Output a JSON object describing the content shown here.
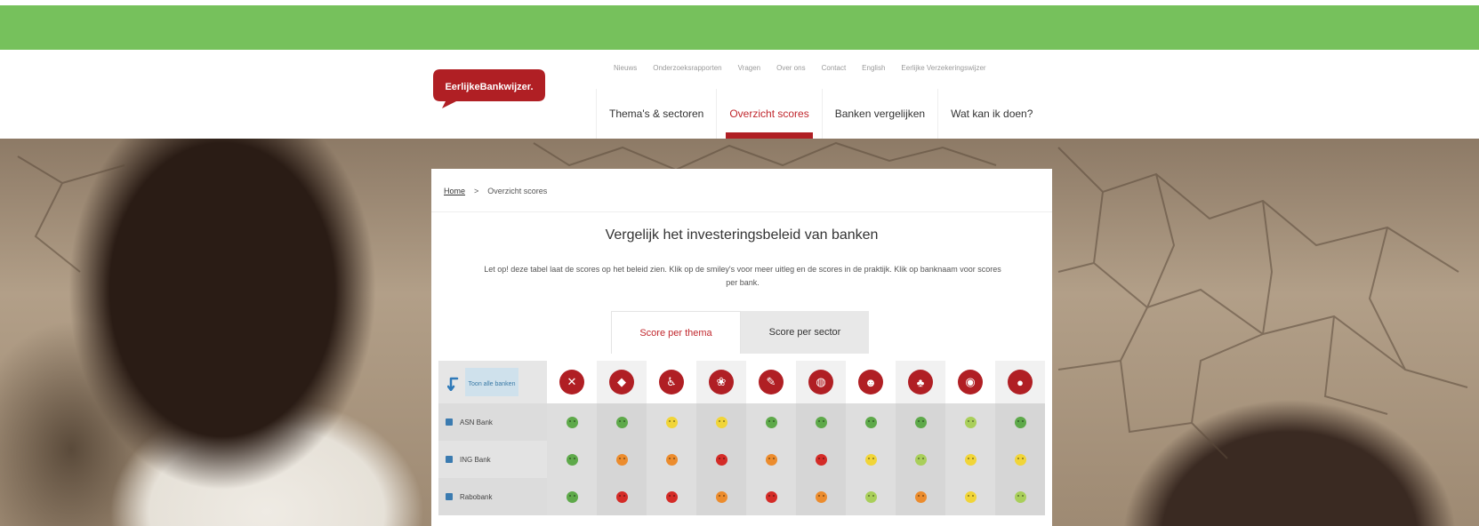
{
  "header": {
    "logo_text": "EerlijkeBankwijzer.",
    "util_nav": [
      "Nieuws",
      "Onderzoeksrapporten",
      "Vragen",
      "Over ons",
      "Contact",
      "English",
      "Eerlijke Verzekeringswijzer"
    ],
    "main_nav": [
      {
        "label": "Thema's & sectoren",
        "active": false
      },
      {
        "label": "Overzicht scores",
        "active": true
      },
      {
        "label": "Banken vergelijken",
        "active": false
      },
      {
        "label": "Wat kan ik doen?",
        "active": false
      }
    ]
  },
  "breadcrumb": {
    "home": "Home",
    "separator": ">",
    "current": "Overzicht scores"
  },
  "title": "Vergelijk het investeringsbeleid van banken",
  "intro": "Let op! deze tabel laat de scores op het beleid zien. Klik op de smiley's voor meer uitleg en de scores in de praktijk. Klik op banknaam voor scores per bank.",
  "tabs": [
    {
      "label": "Score per thema",
      "active": true
    },
    {
      "label": "Score per sector",
      "active": false
    }
  ],
  "table": {
    "show_all_label": "Toon alle banken",
    "themes": [
      {
        "icon": "tools-icon",
        "glyph": "✕"
      },
      {
        "icon": "tag-icon",
        "glyph": "◆"
      },
      {
        "icon": "person-chair-icon",
        "glyph": "♿"
      },
      {
        "icon": "paw-icon",
        "glyph": "❀"
      },
      {
        "icon": "pencil-icon",
        "glyph": "✎"
      },
      {
        "icon": "globe-icon",
        "glyph": "◍"
      },
      {
        "icon": "people-icon",
        "glyph": "☻"
      },
      {
        "icon": "tree-icon",
        "glyph": "♣"
      },
      {
        "icon": "eye-icon",
        "glyph": "◉"
      },
      {
        "icon": "drop-icon",
        "glyph": "●"
      }
    ],
    "rows": [
      {
        "bank": "ASN Bank",
        "scores": [
          "green",
          "green",
          "yellow",
          "yellow",
          "green",
          "green",
          "green",
          "green",
          "lime",
          "green"
        ]
      },
      {
        "bank": "ING Bank",
        "scores": [
          "green",
          "orange",
          "orange",
          "red",
          "orange",
          "red",
          "yellow",
          "lime",
          "yellow",
          "yellow"
        ]
      },
      {
        "bank": "Rabobank",
        "scores": [
          "green",
          "red",
          "red",
          "orange",
          "red",
          "orange",
          "lime",
          "orange",
          "yellow",
          "lime"
        ]
      }
    ]
  },
  "colors": {
    "green_bar": "#76c15c",
    "brand_red": "#b01f24",
    "score_green": "#5ea94a",
    "score_lime": "#a9cf5a",
    "score_yellow": "#f1d538",
    "score_orange": "#ec8c2d",
    "score_red": "#d42b27"
  }
}
